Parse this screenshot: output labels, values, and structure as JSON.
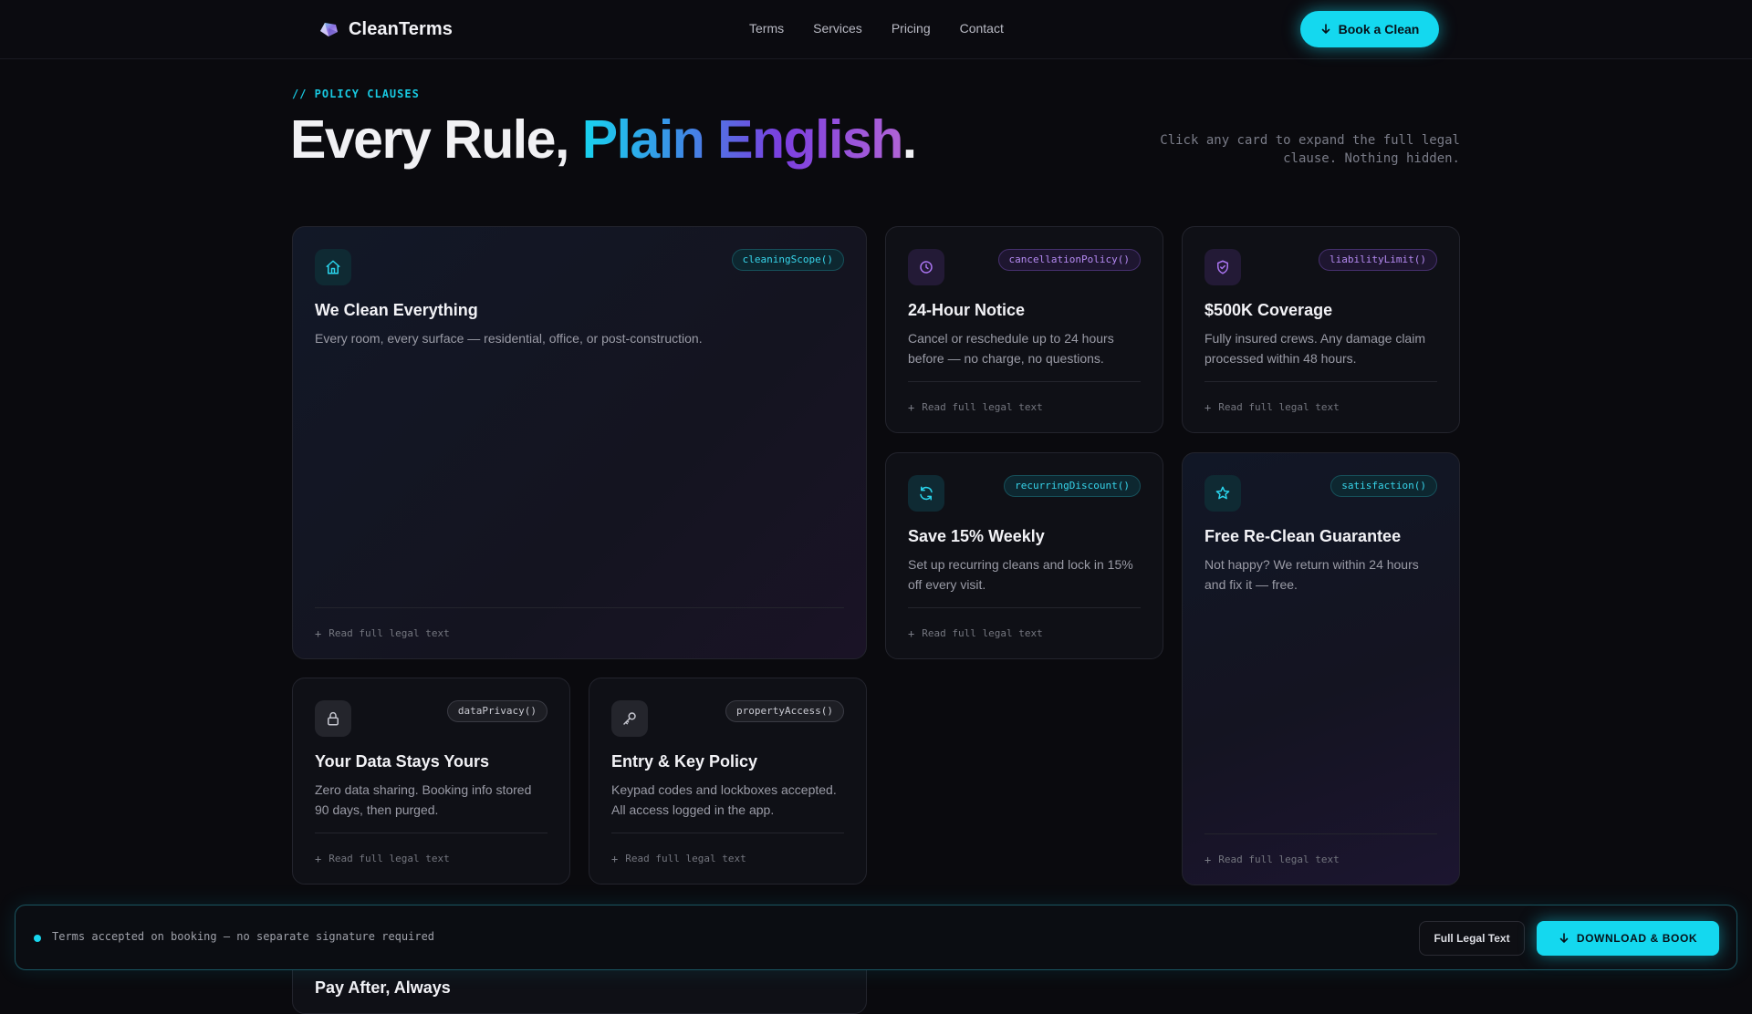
{
  "nav": {
    "brand": "CleanTerms",
    "links": [
      "Terms",
      "Services",
      "Pricing",
      "Contact"
    ],
    "cta": "Book a Clean"
  },
  "hero": {
    "eyebrow": "// POLICY CLAUSES",
    "title_start": "Every Rule, ",
    "title_highlight": "Plain English",
    "title_end": ".",
    "subtitle": "Click any card to expand the full legal clause. Nothing hidden."
  },
  "cards": [
    {
      "tag": "cleaningScope()",
      "title": "We Clean Everything",
      "desc": "Every room, every surface — residential, office, or post-construction.",
      "footer": "Read full legal text"
    },
    {
      "tag": "cancellationPolicy()",
      "title": "24-Hour Notice",
      "desc": "Cancel or reschedule up to 24 hours before — no charge, no questions.",
      "footer": "Read full legal text"
    },
    {
      "tag": "liabilityLimit()",
      "title": "$500K Coverage",
      "desc": "Fully insured crews. Any damage claim processed within 48 hours.",
      "footer": "Read full legal text"
    },
    {
      "tag": "recurringDiscount()",
      "title": "Save 15% Weekly",
      "desc": "Set up recurring cleans and lock in 15% off every visit.",
      "footer": "Read full legal text"
    },
    {
      "tag": "satisfaction()",
      "title": "Free Re-Clean Guarantee",
      "desc": "Not happy? We return within 24 hours and fix it — free.",
      "footer": "Read full legal text"
    },
    {
      "tag": "dataPrivacy()",
      "title": "Your Data Stays Yours",
      "desc": "Zero data sharing. Booking info stored 90 days, then purged.",
      "footer": "Read full legal text"
    },
    {
      "tag": "propertyAccess()",
      "title": "Entry & Key Policy",
      "desc": "Keypad codes and lockboxes accepted. All access logged in the app.",
      "footer": "Read full legal text"
    }
  ],
  "peek_card": {
    "title": "Pay After, Always"
  },
  "bottom_bar": {
    "status": "Terms accepted on booking — no separate signature required",
    "secondary_button": "Full Legal Text",
    "primary_button": "DOWNLOAD & BOOK"
  },
  "colors": {
    "accent_cyan": "#14d8ef",
    "accent_purple": "#a874ef",
    "background": "#0a0a0e"
  },
  "icons": {
    "brand": "diamond-logo-icon",
    "cards": [
      "home-icon",
      "clock-icon",
      "shield-check-icon",
      "refresh-icon",
      "star-icon",
      "lock-icon",
      "key-icon"
    ]
  }
}
